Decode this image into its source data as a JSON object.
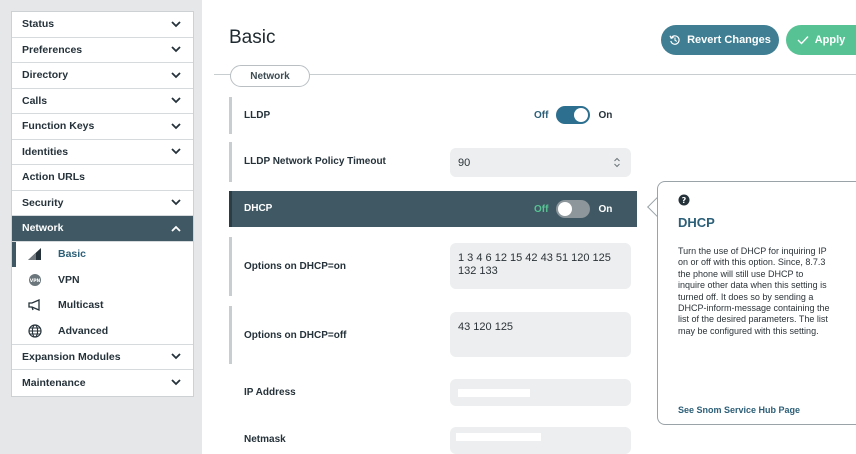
{
  "sidebar": {
    "items": [
      {
        "label": "Status"
      },
      {
        "label": "Preferences"
      },
      {
        "label": "Directory"
      },
      {
        "label": "Calls"
      },
      {
        "label": "Function Keys"
      },
      {
        "label": "Identities"
      },
      {
        "label": "Action URLs"
      },
      {
        "label": "Security"
      },
      {
        "label": "Network"
      },
      {
        "label": "Expansion Modules"
      },
      {
        "label": "Maintenance"
      }
    ],
    "network_sub": [
      {
        "label": "Basic",
        "icon": "signal-icon"
      },
      {
        "label": "VPN",
        "icon": "vpn-icon"
      },
      {
        "label": "Multicast",
        "icon": "megaphone-icon"
      },
      {
        "label": "Advanced",
        "icon": "globe-icon"
      }
    ]
  },
  "header": {
    "title": "Basic",
    "revert_label": "Revert Changes",
    "apply_label": "Apply"
  },
  "section_tab": "Network",
  "settings": {
    "lldp": {
      "label": "LLDP",
      "off": "Off",
      "on": "On",
      "state": "on"
    },
    "lldp_timeout": {
      "label": "LLDP Network Policy Timeout",
      "value": "90"
    },
    "dhcp": {
      "label": "DHCP",
      "off": "Off",
      "on": "On",
      "state": "off"
    },
    "dhcp_on_options": {
      "label": "Options on DHCP=on",
      "value": "1 3 4 6 12 15 42 43 51 120 125 132 133"
    },
    "dhcp_off_options": {
      "label": "Options on DHCP=off",
      "value": "43 120 125"
    },
    "ip_address": {
      "label": "IP Address",
      "value": ""
    },
    "netmask": {
      "label": "Netmask",
      "value": ""
    }
  },
  "help": {
    "title": "DHCP",
    "text": "Turn the use of DHCP for inquiring IP on or off with this option. Since, 8.7.3 the phone will still use DHCP to inquire other data when this setting is turned off. It does so by sending a DHCP-inform-message containing the list of the desired parameters. The list may be configured with this setting.",
    "link": "See Snom Service Hub Page"
  },
  "colors": {
    "accent_dark": "#3f5863",
    "revert_button": "#3f7e93",
    "apply_button": "#57c394",
    "toggle_on": "#2c6f8e",
    "toggle_off_label": "#57c394"
  }
}
